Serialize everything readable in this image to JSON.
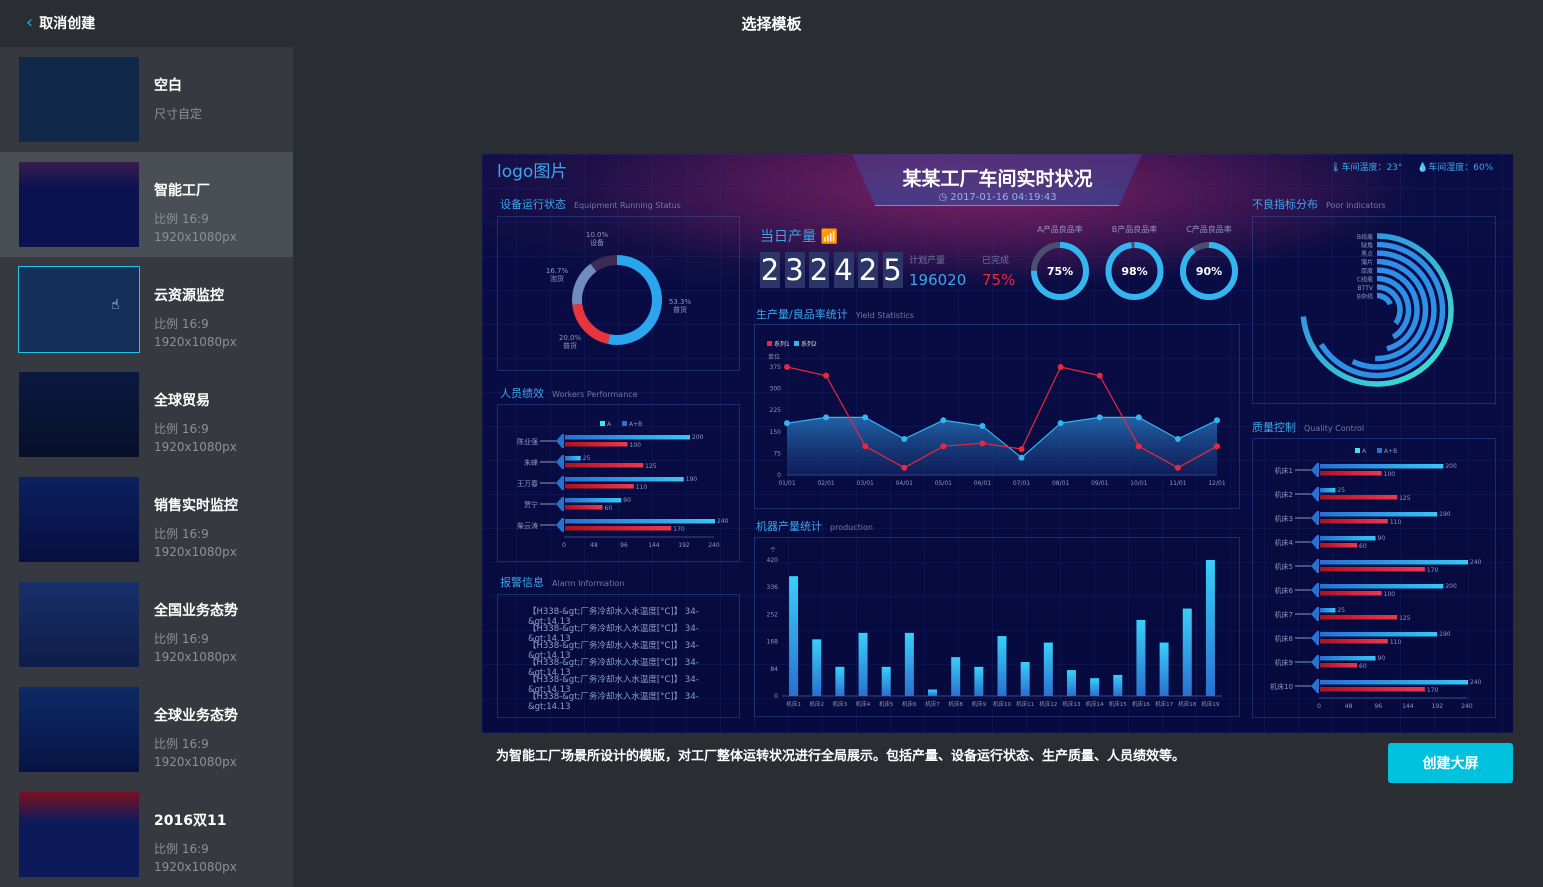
{
  "topbar": {
    "back_label": "取消创建",
    "title": "选择模板",
    "back_icon": "chevron-left-icon"
  },
  "sidebar": {
    "items": [
      {
        "name": "空白",
        "line1": "尺寸自定",
        "line2": ""
      },
      {
        "name": "智能工厂",
        "line1": "比例 16:9",
        "line2": "1920x1080px",
        "selected": true
      },
      {
        "name": "云资源监控",
        "line1": "比例 16:9",
        "line2": "1920x1080px",
        "hovered": true
      },
      {
        "name": "全球贸易",
        "line1": "比例 16:9",
        "line2": "1920x1080px"
      },
      {
        "name": "销售实时监控",
        "line1": "比例 16:9",
        "line2": "1920x1080px"
      },
      {
        "name": "全国业务态势",
        "line1": "比例 16:9",
        "line2": "1920x1080px"
      },
      {
        "name": "全球业务态势",
        "line1": "比例 16:9",
        "line2": "1920x1080px"
      },
      {
        "name": "2016双11",
        "line1": "比例 16:9",
        "line2": "1920x1080px"
      }
    ]
  },
  "preview": {
    "logo": "logo图片",
    "title": "某某工厂车间实时状况",
    "datetime": "2017-01-16 04:19:43",
    "temperature": "车间温度：23°",
    "humidity": "车间湿度：60%",
    "sections": {
      "equipment": {
        "title": "设备运行状态",
        "subtitle": "Equipment Running Status"
      },
      "workers": {
        "title": "人员绩效",
        "subtitle": "Workers Performance"
      },
      "alarm": {
        "title": "报警信息",
        "subtitle": "Alarm Information"
      },
      "daily": {
        "title": "当日产量"
      },
      "yield": {
        "title": "生产量/良品率统计",
        "subtitle": "Yield Statistics"
      },
      "machine": {
        "title": "机器产量统计",
        "subtitle": "production"
      },
      "poor": {
        "title": "不良指标分布",
        "subtitle": "Poor Indicators"
      },
      "quality": {
        "title": "质量控制",
        "subtitle": "Quality Control"
      }
    },
    "daily_output": {
      "digits": [
        "2",
        "3",
        "2",
        "4",
        "2",
        "5"
      ],
      "plan_label": "计划产量",
      "plan_value": "196020",
      "done_label": "已完成",
      "done_value": "75%"
    },
    "gauges": [
      {
        "label": "A产品良品率",
        "value": "75%",
        "pct": 75
      },
      {
        "label": "B产品良品率",
        "value": "98%",
        "pct": 98
      },
      {
        "label": "C产品良品率",
        "value": "90%",
        "pct": 90
      }
    ],
    "alarms": [
      "【H338-&gt;厂务冷却水入水温度[°C]】 34-&gt;14.13",
      "【H338-&gt;厂务冷却水入水温度[°C]】 34-&gt;14.13",
      "【H338-&gt;厂务冷却水入水温度[°C]】 34-&gt;14.13",
      "【H338-&gt;厂务冷却水入水温度[°C]】 34-&gt;14.13",
      "【H338-&gt;厂务冷却水入水温度[°C]】 34-&gt;14.13",
      "【H338-&gt;厂务冷却水入水温度[°C]】 34-&gt;14.13"
    ],
    "description": "为智能工厂场景所设计的模版，对工厂整体运转状况进行全局展示。包括产量、设备运行状态、生产质量、人员绩效等。",
    "create_button": "创建大屏"
  },
  "colors": {
    "accent": "#00c1de",
    "blue": "#33b6f0",
    "red": "#e8283c",
    "panel_bg": "#070b3e"
  },
  "chart_data": [
    {
      "type": "pie",
      "id": "equipment",
      "slices": [
        {
          "label": "普货",
          "value": 53.3,
          "text": "53.3%",
          "color": "#2aa5ee"
        },
        {
          "label": "普货",
          "value": 20.0,
          "text": "20.0%",
          "color": "#e8343c"
        },
        {
          "label": "泡货",
          "value": 16.7,
          "text": "16.7%",
          "color": "#6f8bc0"
        },
        {
          "label": "设备",
          "value": 10.0,
          "text": "10.0%",
          "color": "#3c2b55"
        }
      ]
    },
    {
      "type": "bar",
      "id": "workers",
      "orientation": "horizontal",
      "legend": [
        "A",
        "A+B"
      ],
      "categories": [
        "陈业强",
        "朱峰",
        "王万春",
        "贾宁",
        "柴云涛"
      ],
      "series": [
        {
          "name": "A",
          "values": [
            200,
            25,
            190,
            90,
            240
          ]
        },
        {
          "name": "A+B",
          "values": [
            100,
            125,
            110,
            60,
            170
          ]
        }
      ],
      "xlim": [
        0,
        240
      ],
      "ticks": [
        "0",
        "48",
        "96",
        "144",
        "192",
        "240"
      ]
    },
    {
      "type": "line",
      "id": "yield",
      "legend": [
        "系列1",
        "系列2"
      ],
      "ylabel": "单位",
      "categories": [
        "01/01",
        "02/01",
        "03/01",
        "04/01",
        "05/01",
        "06/01",
        "07/01",
        "08/01",
        "09/01",
        "10/01",
        "11/01",
        "12/01"
      ],
      "series": [
        {
          "name": "系列1",
          "color": "#e8283c",
          "values": [
            375,
            345,
            100,
            25,
            100,
            110,
            90,
            375,
            345,
            100,
            25,
            100
          ]
        },
        {
          "name": "系列2",
          "color": "#33b6f0",
          "area": true,
          "values": [
            180,
            200,
            200,
            125,
            190,
            170,
            60,
            180,
            200,
            200,
            125,
            190
          ]
        }
      ],
      "ylim": [
        0,
        375
      ],
      "ticks": [
        "0",
        "75",
        "150",
        "225",
        "300",
        "375"
      ]
    },
    {
      "type": "bar",
      "id": "machine",
      "ylabel": "个",
      "categories": [
        "机床1",
        "机床2",
        "机床3",
        "机床4",
        "机床5",
        "机床6",
        "机床7",
        "机床8",
        "机床9",
        "机床10",
        "机床11",
        "机床12",
        "机床13",
        "机床14",
        "机床15",
        "机床16",
        "机床17",
        "机床18",
        "机床19"
      ],
      "values": [
        370,
        175,
        90,
        195,
        90,
        195,
        20,
        120,
        90,
        185,
        105,
        165,
        80,
        55,
        65,
        235,
        165,
        270,
        420
      ],
      "ylim": [
        0,
        420
      ],
      "ticks": [
        "0",
        "84",
        "168",
        "252",
        "336",
        "420"
      ]
    },
    {
      "type": "radial-bar",
      "id": "poor",
      "categories": [
        "B线痕",
        "缺角",
        "黑点",
        "薄片",
        "厚度",
        "C线痕",
        "BTTV",
        "B杂线"
      ],
      "values": [
        0.8,
        0.72,
        0.62,
        0.55,
        0.5,
        0.45,
        0.38,
        0.2
      ]
    },
    {
      "type": "bar",
      "id": "quality",
      "orientation": "horizontal",
      "legend": [
        "A",
        "A+B"
      ],
      "categories": [
        "机床1",
        "机床2",
        "机床3",
        "机床4",
        "机床5",
        "机床6",
        "机床7",
        "机床8",
        "机床9",
        "机床10"
      ],
      "series": [
        {
          "name": "A",
          "values": [
            200,
            25,
            190,
            90,
            240,
            200,
            25,
            190,
            90,
            240
          ]
        },
        {
          "name": "A+B",
          "values": [
            100,
            125,
            110,
            60,
            170,
            100,
            125,
            110,
            60,
            170
          ]
        }
      ],
      "xlim": [
        0,
        240
      ],
      "ticks": [
        "0",
        "48",
        "96",
        "144",
        "192",
        "240"
      ]
    }
  ]
}
